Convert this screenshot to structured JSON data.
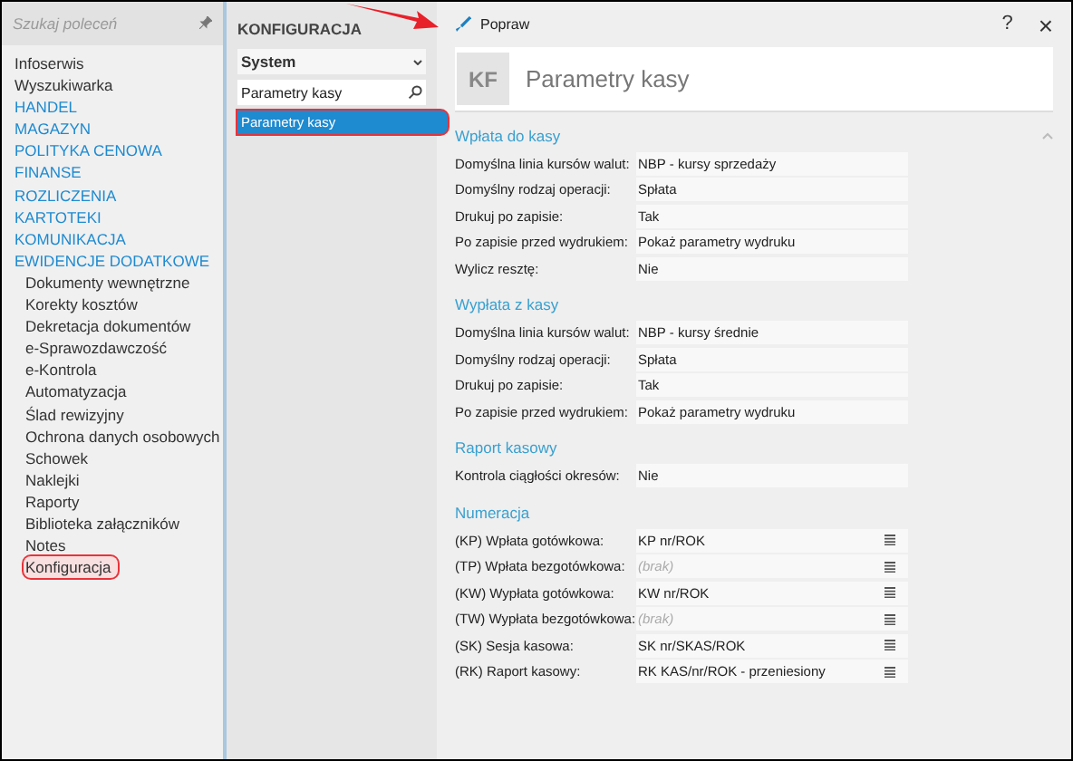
{
  "annotation_arrow": true,
  "sidebar": {
    "search": {
      "placeholder": "Szukaj poleceń"
    },
    "items": [
      {
        "label": "Infoserwis",
        "kind": "item",
        "annotated": false
      },
      {
        "label": "Wyszukiwarka",
        "kind": "item",
        "annotated": false
      },
      {
        "label": "HANDEL",
        "kind": "group",
        "annotated": false
      },
      {
        "label": "MAGAZYN",
        "kind": "group",
        "annotated": false
      },
      {
        "label": "POLITYKA CENOWA",
        "kind": "group",
        "annotated": false
      },
      {
        "label": "FINANSE",
        "kind": "group",
        "annotated": false
      },
      {
        "label": "ROZLICZENIA",
        "kind": "group",
        "annotated": false
      },
      {
        "label": "KARTOTEKI",
        "kind": "group",
        "annotated": false
      },
      {
        "label": "KOMUNIKACJA",
        "kind": "group",
        "annotated": false
      },
      {
        "label": "EWIDENCJE DODATKOWE",
        "kind": "group",
        "annotated": false,
        "children": [
          {
            "label": "Dokumenty wewnętrzne",
            "kind": "item",
            "annotated": false
          },
          {
            "label": "Korekty kosztów",
            "kind": "item",
            "annotated": false
          },
          {
            "label": "Dekretacja dokumentów",
            "kind": "item",
            "annotated": false
          },
          {
            "label": "e-Sprawozdawczość",
            "kind": "item",
            "annotated": false
          },
          {
            "label": "e-Kontrola",
            "kind": "item",
            "annotated": false
          },
          {
            "label": "Automatyzacja",
            "kind": "item",
            "annotated": false
          },
          {
            "label": "Ślad rewizyjny",
            "kind": "item",
            "annotated": false
          },
          {
            "label": "Ochrona danych osobowych",
            "kind": "item",
            "annotated": false
          },
          {
            "label": "Schowek",
            "kind": "item",
            "annotated": false
          },
          {
            "label": "Naklejki",
            "kind": "item",
            "annotated": false
          },
          {
            "label": "Raporty",
            "kind": "item",
            "annotated": false
          },
          {
            "label": "Biblioteka załączników",
            "kind": "item",
            "annotated": false
          },
          {
            "label": "Notes",
            "kind": "item",
            "annotated": false
          },
          {
            "label": "Konfiguracja",
            "kind": "item",
            "annotated": true
          }
        ]
      }
    ]
  },
  "config": {
    "title": "KONFIGURACJA",
    "dropdown": {
      "value": "System"
    },
    "search": {
      "value": "Parametry kasy"
    },
    "results": [
      {
        "label": "Parametry kasy",
        "selected": true,
        "annotated": true
      }
    ]
  },
  "toolbar": {
    "edit_button": "Popraw",
    "help_button": "?",
    "close_button": "×"
  },
  "form": {
    "badge": "KF",
    "title": "Parametry kasy",
    "sections": [
      {
        "title": "Wpłata do kasy",
        "collapse_icon": true,
        "rows": [
          {
            "label": "Domyślna linia kursów walut:",
            "value": "NBP - kursy sprzedaży",
            "menu": false
          },
          {
            "label": "Domyślny rodzaj operacji:",
            "value": "Spłata",
            "menu": false
          },
          {
            "label": "Drukuj po zapisie:",
            "value": "Tak",
            "menu": false
          },
          {
            "label": "Po zapisie przed wydrukiem:",
            "value": "Pokaż parametry wydruku",
            "menu": false
          },
          {
            "label": "Wylicz resztę:",
            "value": "Nie",
            "menu": false
          }
        ]
      },
      {
        "title": "Wypłata z kasy",
        "collapse_icon": false,
        "rows": [
          {
            "label": "Domyślna linia kursów walut:",
            "value": "NBP - kursy średnie",
            "menu": false
          },
          {
            "label": "Domyślny rodzaj operacji:",
            "value": "Spłata",
            "menu": false
          },
          {
            "label": "Drukuj po zapisie:",
            "value": "Tak",
            "menu": false
          },
          {
            "label": "Po zapisie przed wydrukiem:",
            "value": "Pokaż parametry wydruku",
            "menu": false
          }
        ]
      },
      {
        "title": "Raport kasowy",
        "collapse_icon": false,
        "rows": [
          {
            "label": "Kontrola ciągłości okresów:",
            "value": "Nie",
            "menu": false
          }
        ]
      },
      {
        "title": "Numeracja",
        "collapse_icon": false,
        "rows": [
          {
            "label": "(KP) Wpłata gotówkowa:",
            "value": "KP nr/ROK",
            "menu": true
          },
          {
            "label": "(TP) Wpłata bezgotówkowa:",
            "placeholder": "(brak)",
            "menu": true
          },
          {
            "label": "(KW) Wypłata gotówkowa:",
            "value": "KW nr/ROK",
            "menu": true
          },
          {
            "label": "(TW) Wypłata bezgotówkowa:",
            "placeholder": "(brak)",
            "menu": true
          },
          {
            "label": "(SK) Sesja kasowa:",
            "value": "SK nr/SKAS/ROK",
            "menu": true
          },
          {
            "label": "(RK) Raport kasowy:",
            "value": "RK KAS/nr/ROK - przeniesiony",
            "menu": true
          }
        ]
      }
    ]
  }
}
